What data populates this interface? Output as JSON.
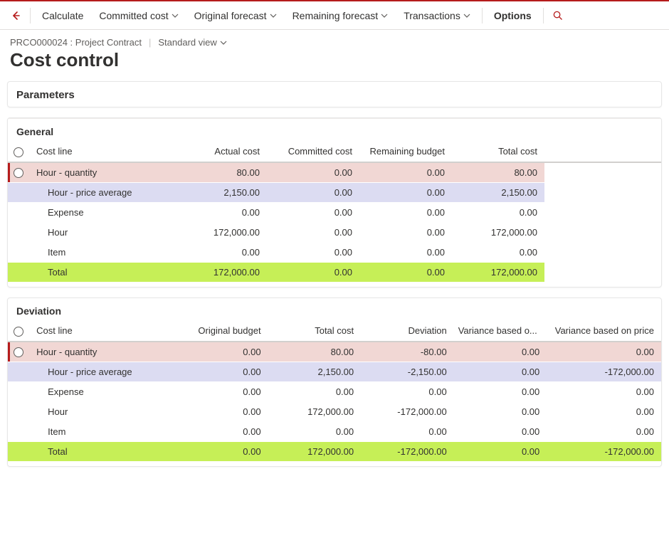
{
  "toolbar": {
    "calculate": "Calculate",
    "committed_cost": "Committed cost",
    "original_forecast": "Original forecast",
    "remaining_forecast": "Remaining forecast",
    "transactions": "Transactions",
    "options": "Options"
  },
  "breadcrumb": {
    "contract": "PRCO000024 : Project Contract",
    "view_label": "Standard view"
  },
  "page_title": "Cost control",
  "sections": {
    "parameters": "Parameters",
    "general": "General",
    "deviation": "Deviation"
  },
  "general_grid": {
    "headers": {
      "cost_line": "Cost line",
      "actual_cost": "Actual cost",
      "committed_cost": "Committed cost",
      "remaining_budget": "Remaining budget",
      "total_cost": "Total cost"
    },
    "rows": [
      {
        "style": "pink",
        "radio": true,
        "name": "Hour - quantity",
        "c1": "80.00",
        "c2": "0.00",
        "c3": "0.00",
        "c4": "80.00"
      },
      {
        "style": "lav",
        "radio": false,
        "indent": true,
        "name": "Hour - price average",
        "c1": "2,150.00",
        "c2": "0.00",
        "c3": "0.00",
        "c4": "2,150.00"
      },
      {
        "style": "plain",
        "radio": false,
        "indent": true,
        "name": "Expense",
        "c1": "0.00",
        "c2": "0.00",
        "c3": "0.00",
        "c4": "0.00"
      },
      {
        "style": "plain",
        "radio": false,
        "indent": true,
        "name": "Hour",
        "c1": "172,000.00",
        "c2": "0.00",
        "c3": "0.00",
        "c4": "172,000.00"
      },
      {
        "style": "plain",
        "radio": false,
        "indent": true,
        "name": "Item",
        "c1": "0.00",
        "c2": "0.00",
        "c3": "0.00",
        "c4": "0.00"
      },
      {
        "style": "grn",
        "radio": false,
        "indent": true,
        "name": "Total",
        "c1": "172,000.00",
        "c2": "0.00",
        "c3": "0.00",
        "c4": "172,000.00"
      }
    ]
  },
  "deviation_grid": {
    "headers": {
      "cost_line": "Cost line",
      "original_budget": "Original budget",
      "total_cost": "Total cost",
      "deviation": "Deviation",
      "var_qty": "Variance based o...",
      "var_price": "Variance based on price"
    },
    "rows": [
      {
        "style": "pink",
        "radio": true,
        "name": "Hour - quantity",
        "c1": "0.00",
        "c2": "80.00",
        "c3": "-80.00",
        "c4": "0.00",
        "c5": "0.00"
      },
      {
        "style": "lav",
        "radio": false,
        "indent": true,
        "name": "Hour - price average",
        "c1": "0.00",
        "c2": "2,150.00",
        "c3": "-2,150.00",
        "c4": "0.00",
        "c5": "-172,000.00"
      },
      {
        "style": "plain",
        "radio": false,
        "indent": true,
        "name": "Expense",
        "c1": "0.00",
        "c2": "0.00",
        "c3": "0.00",
        "c4": "0.00",
        "c5": "0.00"
      },
      {
        "style": "plain",
        "radio": false,
        "indent": true,
        "name": "Hour",
        "c1": "0.00",
        "c2": "172,000.00",
        "c3": "-172,000.00",
        "c4": "0.00",
        "c5": "0.00"
      },
      {
        "style": "plain",
        "radio": false,
        "indent": true,
        "name": "Item",
        "c1": "0.00",
        "c2": "0.00",
        "c3": "0.00",
        "c4": "0.00",
        "c5": "0.00"
      },
      {
        "style": "grn",
        "radio": false,
        "indent": true,
        "name": "Total",
        "c1": "0.00",
        "c2": "172,000.00",
        "c3": "-172,000.00",
        "c4": "0.00",
        "c5": "-172,000.00"
      }
    ]
  }
}
